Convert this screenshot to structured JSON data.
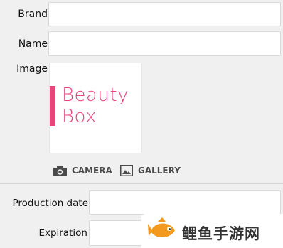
{
  "form": {
    "brand_label": "Brand",
    "brand_value": "",
    "name_label": "Name",
    "name_value": "",
    "image_label": "Image",
    "logo_line1": "Beauty",
    "logo_line2": "Box",
    "camera_label": "CAMERA",
    "gallery_label": "GALLERY",
    "production_label": "Production date",
    "production_value": "",
    "expiration_label": "Expiration",
    "expiration_value": ""
  },
  "watermark": {
    "text": "鲤鱼手游网"
  },
  "colors": {
    "logo_pink": "#e8457b",
    "action_gray": "#4a4a4a",
    "divider": "#d6d6d6",
    "watermark_orange": "#f39a1e",
    "watermark_text": "#333333"
  },
  "icons": {
    "camera": "camera-icon",
    "gallery": "gallery-icon",
    "fish": "fish-logo-icon"
  }
}
